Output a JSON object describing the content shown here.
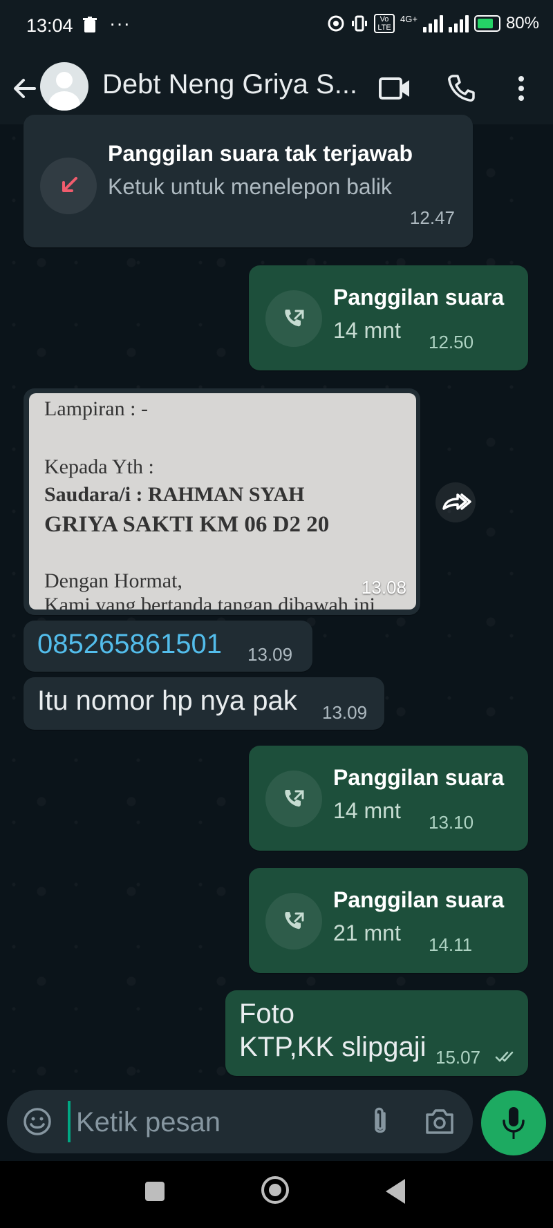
{
  "status_bar": {
    "time": "13:04",
    "dots": "···",
    "network": "4G+",
    "volte": "Vo LTE",
    "battery": "80%"
  },
  "header": {
    "title": "Debt Neng Griya S..."
  },
  "messages": {
    "missed_call": {
      "title": "Panggilan suara tak terjawab",
      "subtitle": "Ketuk untuk menelepon balik",
      "time": "12.47"
    },
    "call1": {
      "title": "Panggilan suara",
      "duration": "14 mnt",
      "time": "12.50"
    },
    "photo": {
      "lines": [
        "Lampiran      : -",
        "Kepada Yth :",
        "Saudara/i : RAHMAN SYAH",
        "GRIYA SAKTI KM 06 D2 20",
        "Dengan Hormat,",
        "Kami yang bertanda tangan dibawah ini"
      ],
      "time": "13.08"
    },
    "phone_number": {
      "text": "085265861501",
      "time": "13.09"
    },
    "text1": {
      "text": "Itu nomor hp nya pak",
      "time": "13.09"
    },
    "call2": {
      "title": "Panggilan suara",
      "duration": "14 mnt",
      "time": "13.10"
    },
    "call3": {
      "title": "Panggilan suara",
      "duration": "21 mnt",
      "time": "14.11"
    },
    "text2": {
      "line1": "Foto",
      "line2": "KTP,KK slipgaji",
      "time": "15.07"
    }
  },
  "composer": {
    "placeholder": "Ketik pesan"
  },
  "colors": {
    "background": "#0b141a",
    "incoming_bubble": "#202c33",
    "outgoing_bubble": "#1d4f3b",
    "accent": "#1daa61",
    "link": "#53bdeb",
    "missed_call_red": "#f15c6d"
  }
}
